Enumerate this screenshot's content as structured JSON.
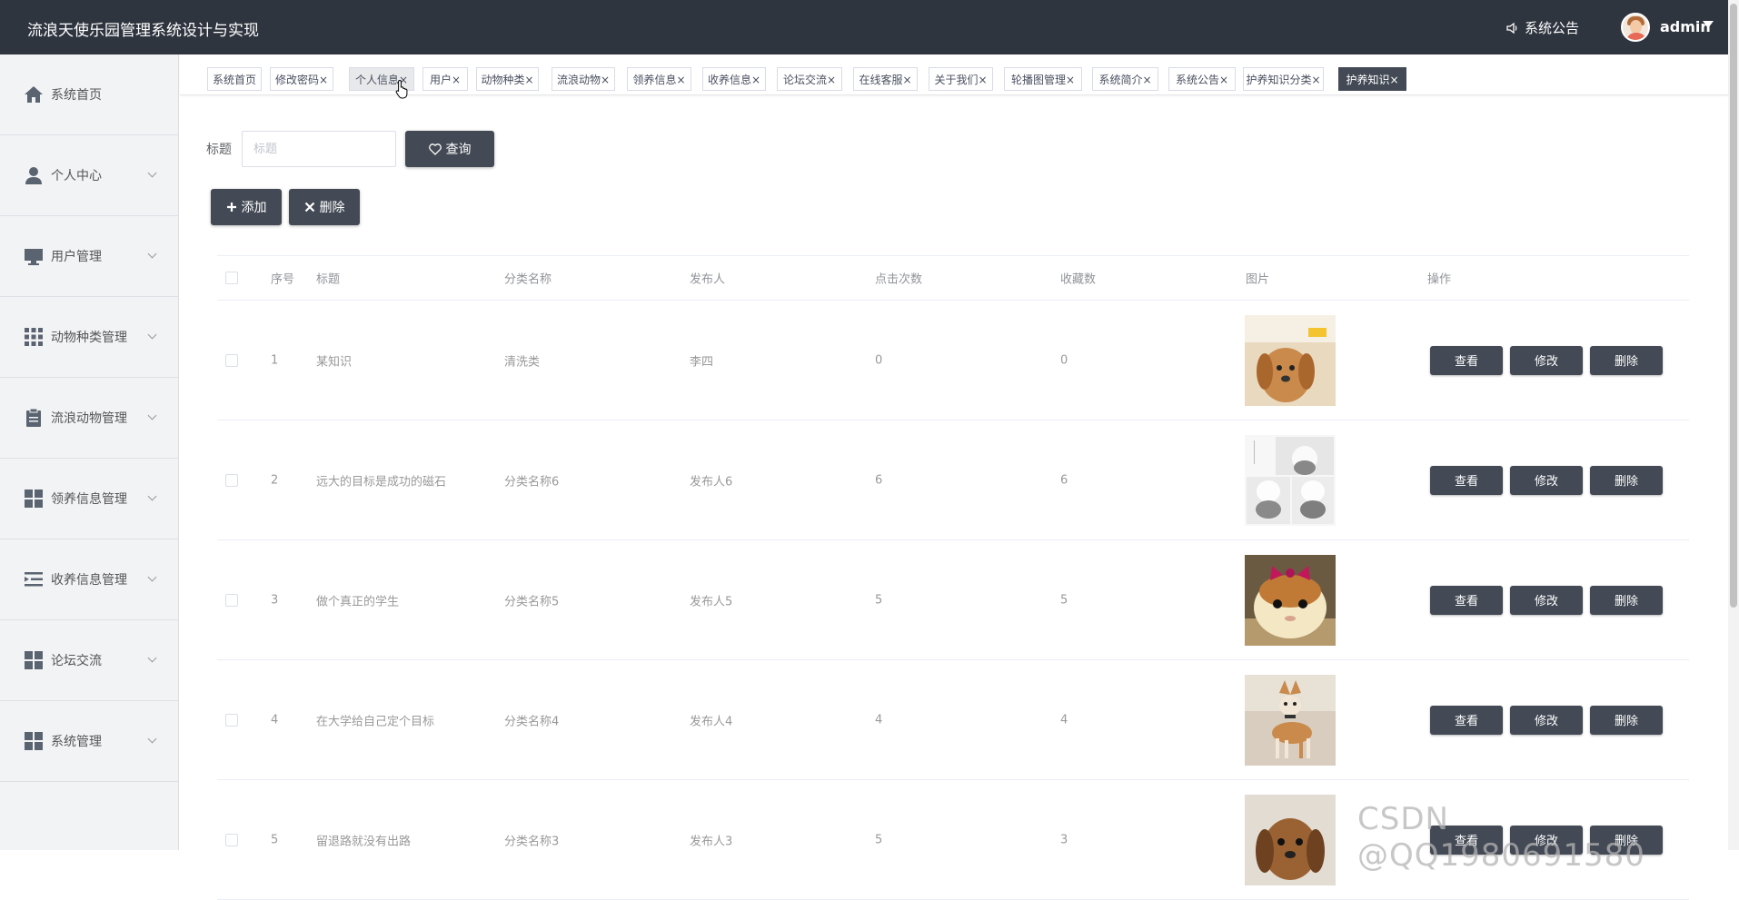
{
  "app": {
    "title": "流浪天使乐园管理系统设计与实现"
  },
  "header": {
    "notice_label": "系统公告",
    "user_name": "admin"
  },
  "sidebar": {
    "items": [
      {
        "label": "系统首页",
        "icon": "home-icon"
      },
      {
        "label": "个人中心",
        "icon": "user-icon"
      },
      {
        "label": "用户管理",
        "icon": "monitor-icon"
      },
      {
        "label": "动物种类管理",
        "icon": "grid-icon"
      },
      {
        "label": "流浪动物管理",
        "icon": "clipboard-icon"
      },
      {
        "label": "领养信息管理",
        "icon": "tiles-icon"
      },
      {
        "label": "收养信息管理",
        "icon": "list-indent-icon"
      },
      {
        "label": "论坛交流",
        "icon": "tiles-icon"
      },
      {
        "label": "系统管理",
        "icon": "tiles-icon"
      }
    ]
  },
  "tabs": [
    {
      "label": "系统首页"
    },
    {
      "label": "修改密码×"
    },
    {
      "label": "个人信息×"
    },
    {
      "label": "用户×"
    },
    {
      "label": "动物种类×"
    },
    {
      "label": "流浪动物×"
    },
    {
      "label": "领养信息×"
    },
    {
      "label": "收养信息×"
    },
    {
      "label": "论坛交流×"
    },
    {
      "label": "在线客服×"
    },
    {
      "label": "关于我们×"
    },
    {
      "label": "轮播图管理×"
    },
    {
      "label": "系统简介×"
    },
    {
      "label": "系统公告×"
    },
    {
      "label": "护养知识分类×"
    },
    {
      "label": "护养知识×"
    }
  ],
  "search": {
    "label": "标题",
    "placeholder": "标题",
    "button": "查询"
  },
  "toolbar": {
    "add": "添加",
    "delete": "删除"
  },
  "table": {
    "headers": [
      "序号",
      "标题",
      "分类名称",
      "发布人",
      "点击次数",
      "收藏数",
      "图片",
      "操作"
    ],
    "rows": [
      {
        "no": "1",
        "title": "某知识",
        "category": "清洗类",
        "publisher": "李四",
        "clicks": "0",
        "favorites": "0"
      },
      {
        "no": "2",
        "title": "远大的目标是成功的磁石",
        "category": "分类名称6",
        "publisher": "发布人6",
        "clicks": "6",
        "favorites": "6"
      },
      {
        "no": "3",
        "title": "做个真正的学生",
        "category": "分类名称5",
        "publisher": "发布人5",
        "clicks": "5",
        "favorites": "5"
      },
      {
        "no": "4",
        "title": "在大学给自己定个目标",
        "category": "分类名称4",
        "publisher": "发布人4",
        "clicks": "4",
        "favorites": "4"
      },
      {
        "no": "5",
        "title": "留退路就没有出路",
        "category": "分类名称3",
        "publisher": "发布人3",
        "clicks": "5",
        "favorites": "3"
      }
    ],
    "actions": {
      "view": "查看",
      "edit": "修改",
      "delete": "删除"
    }
  },
  "watermark": "CSDN @QQ1980691580",
  "colors": {
    "topbar": "#2f353f",
    "button": "#434a55",
    "sidebar": "#f2f3f5"
  }
}
